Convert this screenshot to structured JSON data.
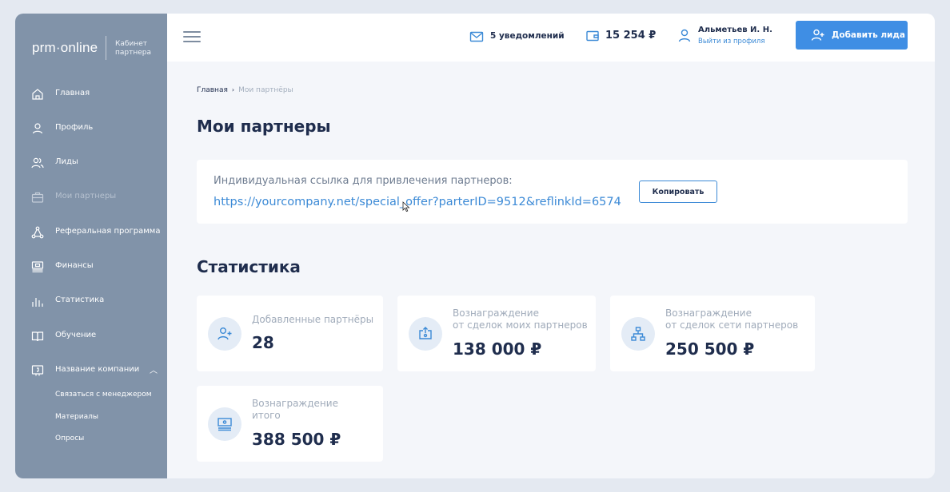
{
  "brand": {
    "logo": "prm·online",
    "subtitle_line1": "Кабинет",
    "subtitle_line2": "партнера"
  },
  "sidebar": {
    "items": [
      {
        "label": "Главная",
        "icon": "home-icon"
      },
      {
        "label": "Профиль",
        "icon": "user-icon"
      },
      {
        "label": "Лиды",
        "icon": "users-icon"
      },
      {
        "label": "Мои партнеры",
        "icon": "briefcase-icon",
        "active": true
      },
      {
        "label": "Реферальная программа",
        "icon": "network-icon"
      },
      {
        "label": "Финансы",
        "icon": "finance-icon"
      },
      {
        "label": "Статистика",
        "icon": "bar-chart-icon"
      },
      {
        "label": "Обучение",
        "icon": "book-icon"
      },
      {
        "label": "Название компании",
        "icon": "company-icon",
        "expanded": true
      }
    ],
    "subitems": [
      "Связаться с менеджером",
      "Материалы",
      "Опросы"
    ]
  },
  "topbar": {
    "notifications": "5 уведомлений",
    "balance": "15 254 ₽",
    "user_name": "Альметьев И. Н.",
    "logout": "Выйти из профиля",
    "add_lead": "Добавить лида"
  },
  "breadcrumb": {
    "home": "Главная",
    "separator": "›",
    "current": "Мои партнёры"
  },
  "page_title": "Мои партнеры",
  "referral": {
    "label": "Индивидуальная ссылка для привлечения партнеров:",
    "link": "https://yourcompany.net/special_offer?parterID=9512&reflinkId=6574",
    "copy_label": "Копировать"
  },
  "stats": {
    "title": "Статистика",
    "cards": [
      {
        "label_line1": "Добавленные партнёры",
        "label_line2": "",
        "value": "28",
        "icon": "add-user-icon"
      },
      {
        "label_line1": "Вознаграждение",
        "label_line2": "от сделок моих партнеров",
        "value": "138 000 ₽",
        "icon": "money-upload-icon"
      },
      {
        "label_line1": "Вознаграждение",
        "label_line2": "от сделок сети партнеров",
        "value": "250 500 ₽",
        "icon": "network-tree-icon"
      },
      {
        "label_line1": "Вознаграждение",
        "label_line2": "итого",
        "value": "388 500 ₽",
        "icon": "cash-stack-icon"
      }
    ]
  },
  "colors": {
    "sidebar": "#8193a9",
    "accent": "#3f8ee4",
    "text_dark": "#1f2d4d",
    "link": "#3c8ad6"
  }
}
